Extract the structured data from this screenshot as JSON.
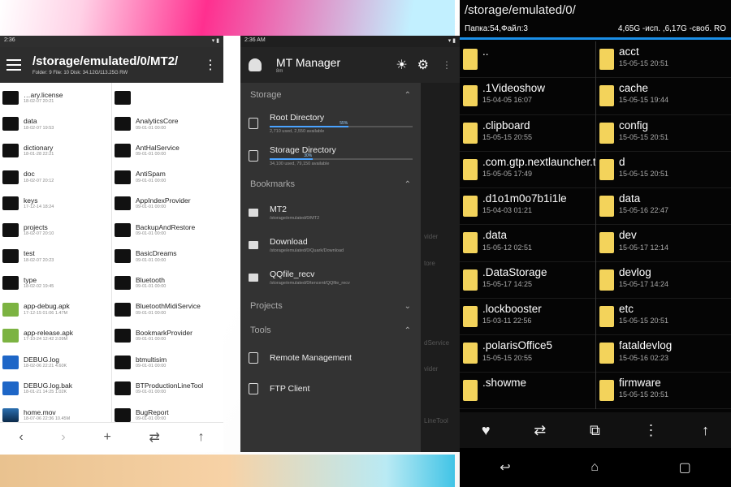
{
  "panel1": {
    "status_time": "2:36",
    "path": "/storage/emulated/0/MT2/",
    "subinfo": "Folder: 9   File: 10   Disk: 34.12G/113.25G  RW",
    "left_items": [
      {
        "name": "…ary.license",
        "date": "18-02-07 20:21",
        "type": "folder"
      },
      {
        "name": "data",
        "date": "18-02-07 19:53",
        "type": "folder"
      },
      {
        "name": "dictionary",
        "date": "18-01-28 22:21",
        "type": "folder"
      },
      {
        "name": "doc",
        "date": "18-02-07 20:12",
        "type": "folder"
      },
      {
        "name": "keys",
        "date": "17-12-14 18:24",
        "type": "folder"
      },
      {
        "name": "projects",
        "date": "18-02-07 20:10",
        "type": "folder"
      },
      {
        "name": "test",
        "date": "18-02-07 20:23",
        "type": "folder"
      },
      {
        "name": "type",
        "date": "18-02-02 19:45",
        "type": "folder"
      },
      {
        "name": "app-debug.apk",
        "date": "17-12-15 01:06  1.47M",
        "type": "apk"
      },
      {
        "name": "app-release.apk",
        "date": "17-10-24 12:42  2.09M",
        "type": "apk"
      },
      {
        "name": "DEBUG.log",
        "date": "18-02-06 22:21  4.60K",
        "type": "log"
      },
      {
        "name": "DEBUG.log.bak",
        "date": "18-01-21 14:25  1.02K",
        "type": "log"
      },
      {
        "name": "home.mov",
        "date": "18-07-06 22:36  10.45M",
        "type": "mov"
      }
    ],
    "right_items": [
      {
        "name": "",
        "date": "",
        "type": "folder"
      },
      {
        "name": "AnalyticsCore",
        "date": "09-01-01 00:00",
        "type": "app"
      },
      {
        "name": "AntHalService",
        "date": "09-01-01 00:00",
        "type": "app"
      },
      {
        "name": "AntiSpam",
        "date": "09-01-01 00:00",
        "type": "app"
      },
      {
        "name": "AppIndexProvider",
        "date": "09-01-01 00:00",
        "type": "app"
      },
      {
        "name": "BackupAndRestore",
        "date": "09-01-01 00:00",
        "type": "app"
      },
      {
        "name": "BasicDreams",
        "date": "09-01-01 00:00",
        "type": "app"
      },
      {
        "name": "Bluetooth",
        "date": "09-01-01 00:00",
        "type": "app"
      },
      {
        "name": "BluetoothMidiService",
        "date": "09-01-01 00:00",
        "type": "app"
      },
      {
        "name": "BookmarkProvider",
        "date": "09-01-01 00:00",
        "type": "app"
      },
      {
        "name": "btmultisim",
        "date": "09-01-01 00:00",
        "type": "app"
      },
      {
        "name": "BTProductionLineTool",
        "date": "09-01-01 00:00",
        "type": "app"
      },
      {
        "name": "BugReport",
        "date": "09-01-01 00:00",
        "type": "app"
      }
    ],
    "bottom": {
      "back": "‹",
      "forward": "›",
      "add": "+",
      "swap": "⇄",
      "up": "↑"
    }
  },
  "panel2": {
    "status_time": "2:36 AM",
    "app_name": "MT Manager",
    "app_version": "8m",
    "sections": {
      "storage": "Storage",
      "bookmarks": "Bookmarks",
      "projects": "Projects",
      "tools": "Tools"
    },
    "storage_items": [
      {
        "name": "Root Directory",
        "sub": "2,710 used, 2,550 available",
        "progress": 0.55,
        "pct": "55%"
      },
      {
        "name": "Storage Directory",
        "sub": "34,100 used, 79,150 available",
        "progress": 0.3,
        "pct": "30%"
      }
    ],
    "bookmark_items": [
      {
        "name": "MT2",
        "sub": "/storage/emulated/0/MT2"
      },
      {
        "name": "Download",
        "sub": "/storage/emulated/0/Quark/Download"
      },
      {
        "name": "QQfile_recv",
        "sub": "/storage/emulated/0/tencent/QQfile_recv"
      }
    ],
    "tool_items": [
      {
        "name": "Remote Management"
      },
      {
        "name": "FTP Client"
      }
    ],
    "behind_labels": [
      "vider",
      "tore",
      "dService",
      "vider",
      "LineTool"
    ]
  },
  "panel3": {
    "path": "/storage/emulated/0/",
    "info_left": "Папка:54,Файл:3",
    "info_right": "4,65G -исп. ,6,17G -своб.  RO",
    "left_items": [
      {
        "name": "..",
        "date": ""
      },
      {
        "name": ".1Videoshow",
        "date": "15-04-05 16:07"
      },
      {
        "name": ".clipboard",
        "date": "15-05-15 20:55"
      },
      {
        "name": ".com.gtp.nextlauncher.trial",
        "date": "15-05-05 17:49"
      },
      {
        "name": ".d1o1m0o7b1i1le",
        "date": "15-04-03 01:21"
      },
      {
        "name": ".data",
        "date": "15-05-12 02:51"
      },
      {
        "name": ".DataStorage",
        "date": "15-05-17 14:25"
      },
      {
        "name": ".lockbooster",
        "date": "15-03-11 22:56"
      },
      {
        "name": ".polarisOffice5",
        "date": "15-05-15 20:55"
      },
      {
        "name": ".showme",
        "date": ""
      }
    ],
    "right_items": [
      {
        "name": "acct",
        "date": "15-05-15 20:51"
      },
      {
        "name": "cache",
        "date": "15-05-15 19:44"
      },
      {
        "name": "config",
        "date": "15-05-15 20:51"
      },
      {
        "name": "d",
        "date": "15-05-15 20:51"
      },
      {
        "name": "data",
        "date": "15-05-16 22:47"
      },
      {
        "name": "dev",
        "date": "15-05-17 12:14"
      },
      {
        "name": "devlog",
        "date": "15-05-17 14:24"
      },
      {
        "name": "etc",
        "date": "15-05-15 20:51"
      },
      {
        "name": "fataldevlog",
        "date": "15-05-16 02:23"
      },
      {
        "name": "firmware",
        "date": "15-05-15 20:51"
      }
    ],
    "toolbar": {
      "favorite": "♥",
      "swap": "⇄",
      "copy": "⧉",
      "more": "⋮",
      "up": "↑"
    },
    "nav": {
      "back": "↩",
      "home": "⌂",
      "recents": "▢"
    }
  }
}
